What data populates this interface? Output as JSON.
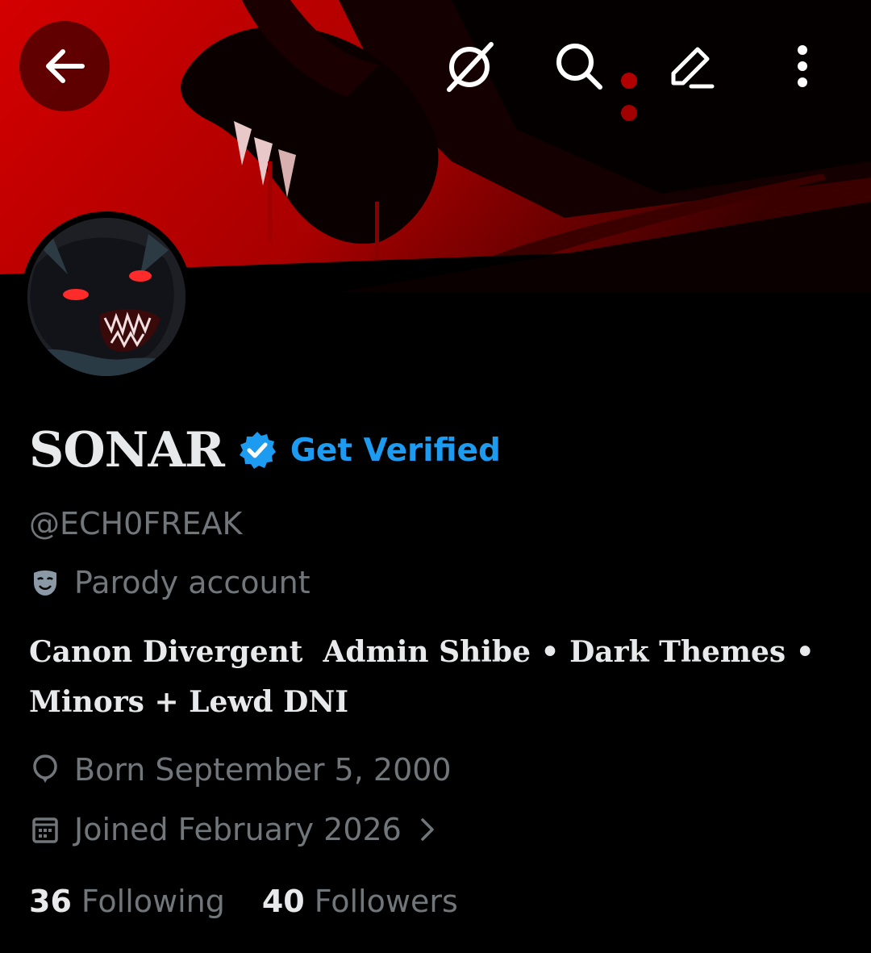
{
  "header": {
    "back_icon": "arrow-left-icon",
    "mute_icon": "notifications-off-icon",
    "search_icon": "search-icon",
    "edit_icon": "pencil-icon",
    "more_icon": "more-vertical-icon"
  },
  "profile": {
    "display_name": "SONAR",
    "verified_icon": "verified-check-icon",
    "get_verified_label": "Get Verified",
    "handle": "@ECH0FREAK",
    "parody_label": "Parody account",
    "bio": "Canon Divergent  Admin Shibe • Dark Themes • Minors + Lewd DNI",
    "birth_date": "Born September 5, 2000",
    "joined_date": "Joined February 2026",
    "following_count": "36",
    "following_label": "Following",
    "followers_count": "40",
    "followers_label": "Followers"
  },
  "colors": {
    "background": "#000000",
    "banner_red": "#c40000",
    "accent_blue": "#1d9bf0",
    "primary_text": "#e7e9ea",
    "secondary_text": "#71767b"
  }
}
